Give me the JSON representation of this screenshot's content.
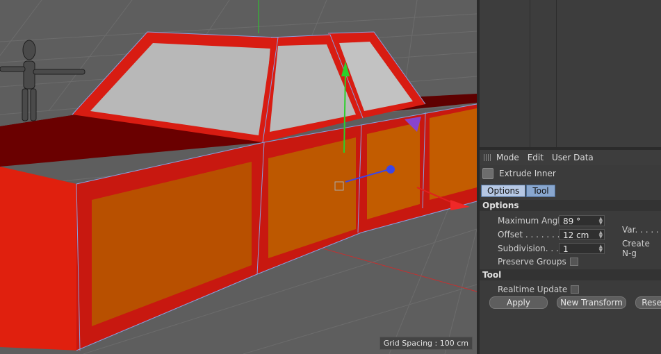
{
  "viewport": {
    "grid_spacing_label": "Grid Spacing : 100 cm"
  },
  "attributes": {
    "menu": [
      "Mode",
      "Edit",
      "User Data"
    ],
    "tool_name": "Extrude Inner",
    "tabs": [
      "Options",
      "Tool"
    ],
    "sections": {
      "options": "Options",
      "tool": "Tool"
    },
    "fields": {
      "max_angle_label": "Maximum Angle",
      "max_angle_value": "89 °",
      "offset_label": "Offset . . . . . . . .",
      "offset_value": "12 cm",
      "subdivision_label": "Subdivision. . . .",
      "subdivision_value": "1",
      "var_label": "Var. . . . . . . .",
      "create_ngons_label": "Create N-g",
      "preserve_groups_label": "Preserve Groups",
      "realtime_update_label": "Realtime Update"
    },
    "buttons": {
      "apply": "Apply",
      "new_transform": "New Transform",
      "reset": "Reset"
    }
  }
}
